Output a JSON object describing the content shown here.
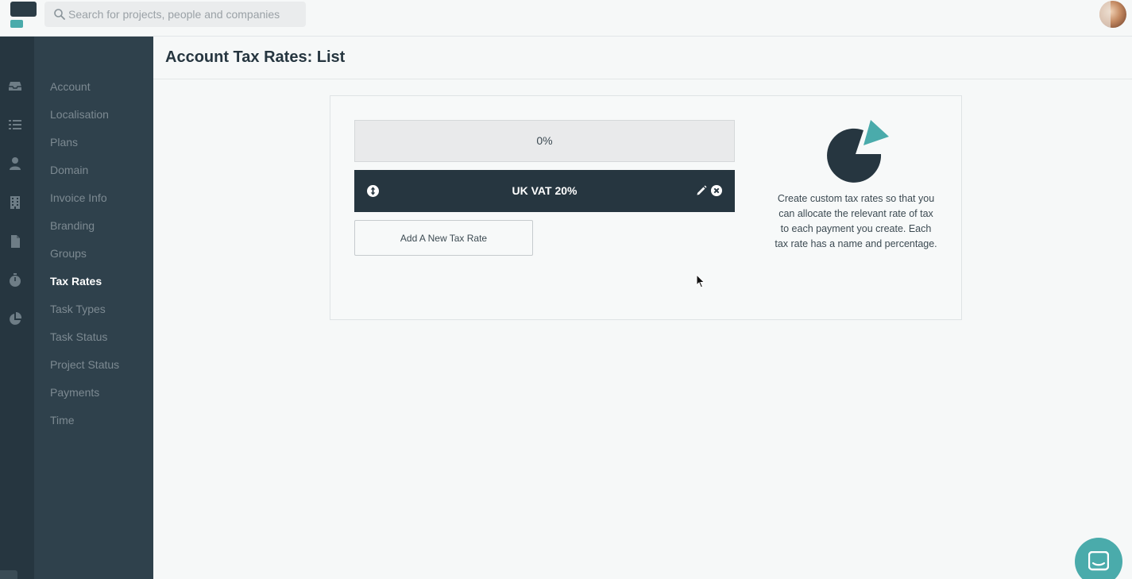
{
  "search": {
    "placeholder": "Search for projects, people and companies"
  },
  "page": {
    "title": "Account Tax Rates: List"
  },
  "sidebar": {
    "items": [
      {
        "label": "Account"
      },
      {
        "label": "Localisation"
      },
      {
        "label": "Plans"
      },
      {
        "label": "Domain"
      },
      {
        "label": "Invoice Info"
      },
      {
        "label": "Branding"
      },
      {
        "label": "Groups"
      },
      {
        "label": "Tax Rates",
        "active": true
      },
      {
        "label": "Task Types"
      },
      {
        "label": "Task Status"
      },
      {
        "label": "Project Status"
      },
      {
        "label": "Payments"
      },
      {
        "label": "Time"
      }
    ]
  },
  "rail_icons": [
    "inbox-icon",
    "list-icon",
    "person-icon",
    "building-icon",
    "document-icon",
    "stopwatch-icon",
    "pie-chart-icon"
  ],
  "tax_rates": {
    "items": [
      {
        "label": "0%"
      },
      {
        "label": "UK VAT 20%"
      }
    ],
    "add_button_label": "Add A New Tax Rate"
  },
  "info": {
    "text": "Create custom tax rates so that you can allocate the relevant rate of tax to each payment you create. Each tax rate has a name and percentage."
  },
  "colors": {
    "accent": "#4aabab",
    "dark": "#263640",
    "sidebar": "#2f414c"
  }
}
